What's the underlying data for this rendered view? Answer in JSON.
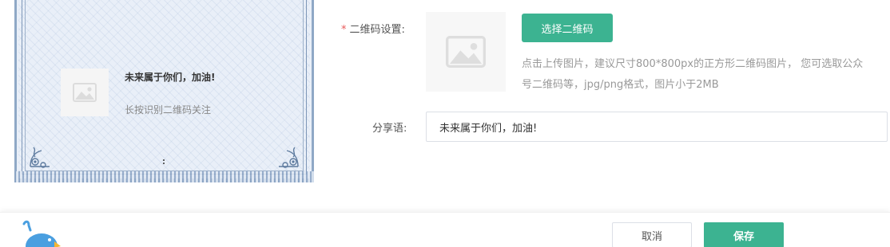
{
  "preview": {
    "title": "未来属于你们，加油!",
    "subtitle": "长按识别二维码关注",
    "thumb_icon": "image-placeholder-icon"
  },
  "form": {
    "qr_label": "二维码设置:",
    "qr_required_mark": "*",
    "select_qr_label": "选择二维码",
    "qr_hint": "点击上传图片，建议尺寸800*800px的正方形二维码图片， 您可选取公众号二维码等，jpg/png格式，图片小于2MB",
    "share_label": "分享语:",
    "share_value": "未来属于你们，加油!"
  },
  "footer": {
    "cancel_label": "取消",
    "save_label": "保存"
  },
  "colors": {
    "accent": "#3cb391",
    "required": "#e85a5a",
    "hint": "#999999"
  }
}
